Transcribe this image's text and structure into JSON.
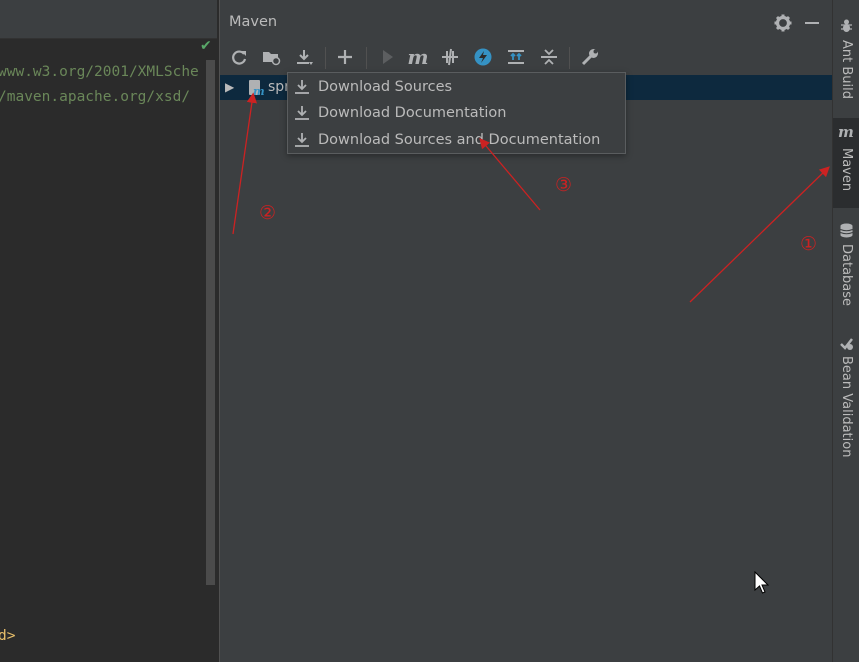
{
  "editor": {
    "code_lines": [
      "www.w3.org/2001/XMLSche",
      "/maven.apache.org/xsd/",
      "d>"
    ]
  },
  "maven": {
    "title": "Maven",
    "toolbar_icons": [
      "reload-icon",
      "generate-sources-icon",
      "download-icon",
      "add-icon",
      "run-icon",
      "execute-goal-icon",
      "toggle-offline-icon",
      "skip-tests-icon",
      "show-dependencies-icon",
      "expand-all-icon",
      "collapse-all-icon",
      "settings-wrench-icon"
    ],
    "tree": {
      "project_label": "spr"
    },
    "dropdown": {
      "items": [
        {
          "label": "Download Sources"
        },
        {
          "label": "Download Documentation"
        },
        {
          "label": "Download Sources and Documentation"
        }
      ]
    }
  },
  "stripe": {
    "items": [
      {
        "label": "Ant Build",
        "icon": "ant-icon"
      },
      {
        "label": "Maven",
        "icon": "maven-icon"
      },
      {
        "label": "Database",
        "icon": "database-icon"
      },
      {
        "label": "Bean Validation",
        "icon": "bean-validation-icon"
      }
    ]
  },
  "annotations": {
    "marker_1": "①",
    "marker_2": "②",
    "marker_3": "③"
  },
  "colors": {
    "panel_bg": "#3c3f41",
    "editor_bg": "#2b2b2b",
    "selection_bg": "#0d293e",
    "annotation_red": "#cc2222",
    "accent_blue": "#3592c4"
  }
}
